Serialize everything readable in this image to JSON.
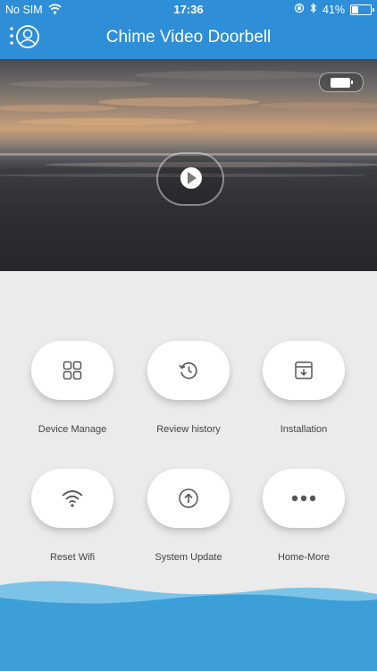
{
  "status_bar": {
    "carrier": "No SIM",
    "time": "17:36",
    "battery_percent": "41%",
    "battery_level": 0.41,
    "icons": [
      "wifi-icon",
      "orientation-lock-icon",
      "bluetooth-icon",
      "battery-icon"
    ]
  },
  "header": {
    "title": "Chime Video Doorbell",
    "menu_icon": "user-menu-icon"
  },
  "video": {
    "play_icon": "play-icon",
    "battery_icon": "battery-icon"
  },
  "actions": [
    {
      "label": "Device Manage",
      "icon": "grid-icon"
    },
    {
      "label": "Review history",
      "icon": "history-icon"
    },
    {
      "label": "Installation",
      "icon": "download-box-icon"
    },
    {
      "label": "Reset Wifi",
      "icon": "wifi-icon"
    },
    {
      "label": "System Update",
      "icon": "upload-circle-icon"
    },
    {
      "label": "Home-More",
      "icon": "more-dots-icon"
    }
  ],
  "colors": {
    "primary": "#2e8ed7",
    "background": "#ebebeb",
    "wave_light": "#7cc3e8",
    "wave_dark": "#3c9fd8"
  }
}
